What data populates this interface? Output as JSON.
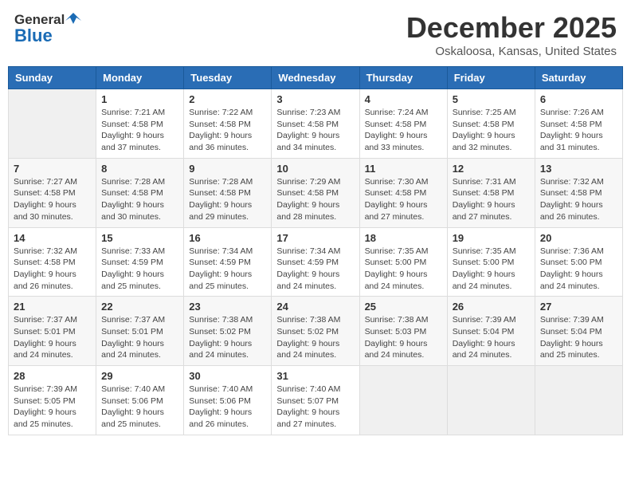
{
  "header": {
    "logo_general": "General",
    "logo_blue": "Blue",
    "month_title": "December 2025",
    "location": "Oskaloosa, Kansas, United States"
  },
  "days_of_week": [
    "Sunday",
    "Monday",
    "Tuesday",
    "Wednesday",
    "Thursday",
    "Friday",
    "Saturday"
  ],
  "weeks": [
    [
      {
        "day": "",
        "info": ""
      },
      {
        "day": "1",
        "info": "Sunrise: 7:21 AM\nSunset: 4:58 PM\nDaylight: 9 hours\nand 37 minutes."
      },
      {
        "day": "2",
        "info": "Sunrise: 7:22 AM\nSunset: 4:58 PM\nDaylight: 9 hours\nand 36 minutes."
      },
      {
        "day": "3",
        "info": "Sunrise: 7:23 AM\nSunset: 4:58 PM\nDaylight: 9 hours\nand 34 minutes."
      },
      {
        "day": "4",
        "info": "Sunrise: 7:24 AM\nSunset: 4:58 PM\nDaylight: 9 hours\nand 33 minutes."
      },
      {
        "day": "5",
        "info": "Sunrise: 7:25 AM\nSunset: 4:58 PM\nDaylight: 9 hours\nand 32 minutes."
      },
      {
        "day": "6",
        "info": "Sunrise: 7:26 AM\nSunset: 4:58 PM\nDaylight: 9 hours\nand 31 minutes."
      }
    ],
    [
      {
        "day": "7",
        "info": "Sunrise: 7:27 AM\nSunset: 4:58 PM\nDaylight: 9 hours\nand 30 minutes."
      },
      {
        "day": "8",
        "info": "Sunrise: 7:28 AM\nSunset: 4:58 PM\nDaylight: 9 hours\nand 30 minutes."
      },
      {
        "day": "9",
        "info": "Sunrise: 7:28 AM\nSunset: 4:58 PM\nDaylight: 9 hours\nand 29 minutes."
      },
      {
        "day": "10",
        "info": "Sunrise: 7:29 AM\nSunset: 4:58 PM\nDaylight: 9 hours\nand 28 minutes."
      },
      {
        "day": "11",
        "info": "Sunrise: 7:30 AM\nSunset: 4:58 PM\nDaylight: 9 hours\nand 27 minutes."
      },
      {
        "day": "12",
        "info": "Sunrise: 7:31 AM\nSunset: 4:58 PM\nDaylight: 9 hours\nand 27 minutes."
      },
      {
        "day": "13",
        "info": "Sunrise: 7:32 AM\nSunset: 4:58 PM\nDaylight: 9 hours\nand 26 minutes."
      }
    ],
    [
      {
        "day": "14",
        "info": "Sunrise: 7:32 AM\nSunset: 4:58 PM\nDaylight: 9 hours\nand 26 minutes."
      },
      {
        "day": "15",
        "info": "Sunrise: 7:33 AM\nSunset: 4:59 PM\nDaylight: 9 hours\nand 25 minutes."
      },
      {
        "day": "16",
        "info": "Sunrise: 7:34 AM\nSunset: 4:59 PM\nDaylight: 9 hours\nand 25 minutes."
      },
      {
        "day": "17",
        "info": "Sunrise: 7:34 AM\nSunset: 4:59 PM\nDaylight: 9 hours\nand 24 minutes."
      },
      {
        "day": "18",
        "info": "Sunrise: 7:35 AM\nSunset: 5:00 PM\nDaylight: 9 hours\nand 24 minutes."
      },
      {
        "day": "19",
        "info": "Sunrise: 7:35 AM\nSunset: 5:00 PM\nDaylight: 9 hours\nand 24 minutes."
      },
      {
        "day": "20",
        "info": "Sunrise: 7:36 AM\nSunset: 5:00 PM\nDaylight: 9 hours\nand 24 minutes."
      }
    ],
    [
      {
        "day": "21",
        "info": "Sunrise: 7:37 AM\nSunset: 5:01 PM\nDaylight: 9 hours\nand 24 minutes."
      },
      {
        "day": "22",
        "info": "Sunrise: 7:37 AM\nSunset: 5:01 PM\nDaylight: 9 hours\nand 24 minutes."
      },
      {
        "day": "23",
        "info": "Sunrise: 7:38 AM\nSunset: 5:02 PM\nDaylight: 9 hours\nand 24 minutes."
      },
      {
        "day": "24",
        "info": "Sunrise: 7:38 AM\nSunset: 5:02 PM\nDaylight: 9 hours\nand 24 minutes."
      },
      {
        "day": "25",
        "info": "Sunrise: 7:38 AM\nSunset: 5:03 PM\nDaylight: 9 hours\nand 24 minutes."
      },
      {
        "day": "26",
        "info": "Sunrise: 7:39 AM\nSunset: 5:04 PM\nDaylight: 9 hours\nand 24 minutes."
      },
      {
        "day": "27",
        "info": "Sunrise: 7:39 AM\nSunset: 5:04 PM\nDaylight: 9 hours\nand 25 minutes."
      }
    ],
    [
      {
        "day": "28",
        "info": "Sunrise: 7:39 AM\nSunset: 5:05 PM\nDaylight: 9 hours\nand 25 minutes."
      },
      {
        "day": "29",
        "info": "Sunrise: 7:40 AM\nSunset: 5:06 PM\nDaylight: 9 hours\nand 25 minutes."
      },
      {
        "day": "30",
        "info": "Sunrise: 7:40 AM\nSunset: 5:06 PM\nDaylight: 9 hours\nand 26 minutes."
      },
      {
        "day": "31",
        "info": "Sunrise: 7:40 AM\nSunset: 5:07 PM\nDaylight: 9 hours\nand 27 minutes."
      },
      {
        "day": "",
        "info": ""
      },
      {
        "day": "",
        "info": ""
      },
      {
        "day": "",
        "info": ""
      }
    ]
  ]
}
